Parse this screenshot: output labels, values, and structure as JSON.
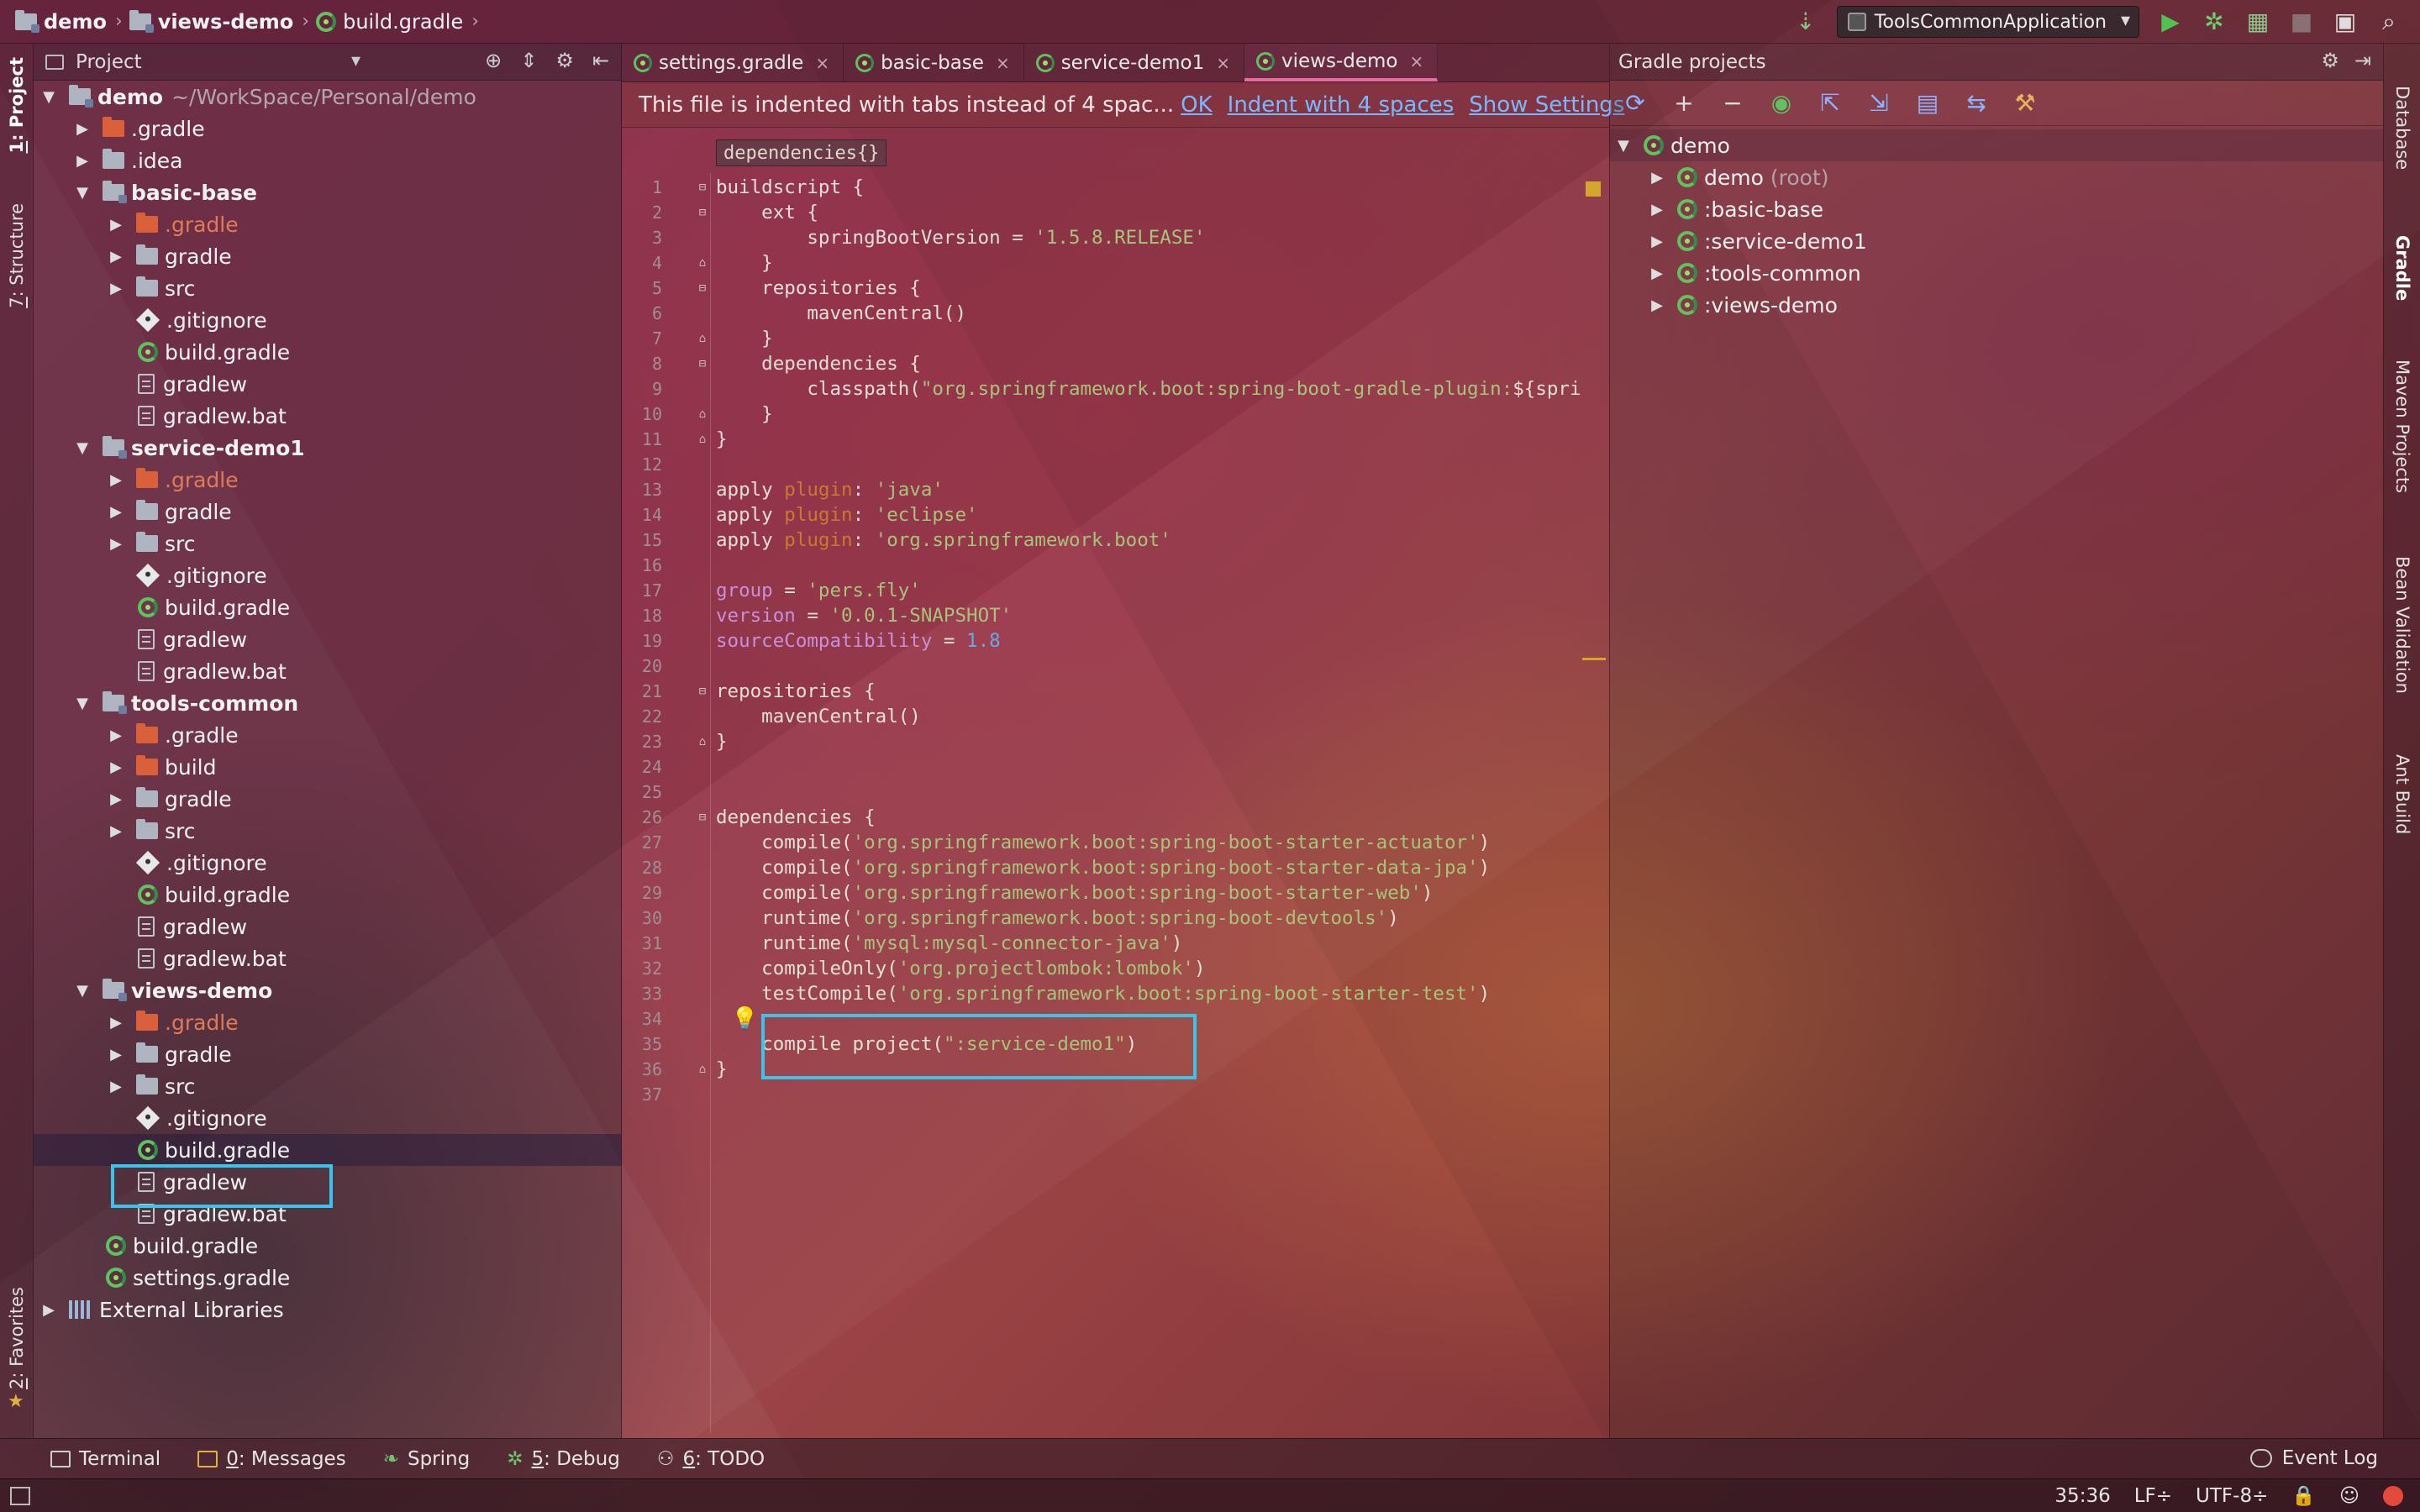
{
  "navbar": {
    "breadcrumb": [
      "demo",
      "views-demo",
      "build.gradle"
    ],
    "run_config": "ToolsCommonApplication"
  },
  "left_strip": {
    "project": {
      "num": "1",
      "label": ": Project"
    },
    "structure": {
      "num": "7",
      "label": ": Structure"
    },
    "favorites": {
      "num": "2",
      "label": ": Favorites"
    }
  },
  "right_strip": [
    "Database",
    "Gradle",
    "Maven Projects",
    "Bean Validation",
    "Ant Build"
  ],
  "project_panel": {
    "title": "Project",
    "tree": [
      {
        "name": "demo",
        "path": "~/WorkSpace/Personal/demo"
      },
      {
        "name": ".gradle"
      },
      {
        "name": ".idea"
      },
      {
        "name": "basic-base"
      },
      {
        "name": ".gradle"
      },
      {
        "name": "gradle"
      },
      {
        "name": "src"
      },
      {
        "name": ".gitignore"
      },
      {
        "name": "build.gradle"
      },
      {
        "name": "gradlew"
      },
      {
        "name": "gradlew.bat"
      },
      {
        "name": "service-demo1"
      },
      {
        "name": ".gradle"
      },
      {
        "name": "gradle"
      },
      {
        "name": "src"
      },
      {
        "name": ".gitignore"
      },
      {
        "name": "build.gradle"
      },
      {
        "name": "gradlew"
      },
      {
        "name": "gradlew.bat"
      },
      {
        "name": "tools-common"
      },
      {
        "name": ".gradle"
      },
      {
        "name": "build"
      },
      {
        "name": "gradle"
      },
      {
        "name": "src"
      },
      {
        "name": ".gitignore"
      },
      {
        "name": "build.gradle"
      },
      {
        "name": "gradlew"
      },
      {
        "name": "gradlew.bat"
      },
      {
        "name": "views-demo"
      },
      {
        "name": ".gradle"
      },
      {
        "name": "gradle"
      },
      {
        "name": "src"
      },
      {
        "name": ".gitignore"
      },
      {
        "name": "build.gradle"
      },
      {
        "name": "gradlew"
      },
      {
        "name": "gradlew.bat"
      },
      {
        "name": "build.gradle"
      },
      {
        "name": "settings.gradle"
      },
      {
        "name": "External Libraries"
      }
    ]
  },
  "editor": {
    "tabs": [
      "settings.gradle",
      "basic-base",
      "service-demo1",
      "views-demo"
    ],
    "notification": {
      "message": "This file is indented with tabs instead of 4 spac...",
      "ok": "OK",
      "indent": "Indent with 4 spaces",
      "settings": "Show Settings"
    },
    "breadcrumb": "dependencies{}",
    "lines": [
      [
        {
          "t": "buildscript {",
          "c": "plain"
        }
      ],
      [
        {
          "t": "    ext {",
          "c": "plain"
        }
      ],
      [
        {
          "t": "        springBootVersion = ",
          "c": "plain"
        },
        {
          "t": "'1.5.8.RELEASE'",
          "c": "str"
        }
      ],
      [
        {
          "t": "    }",
          "c": "plain"
        }
      ],
      [
        {
          "t": "    repositories {",
          "c": "plain"
        }
      ],
      [
        {
          "t": "        mavenCentral()",
          "c": "plain"
        }
      ],
      [
        {
          "t": "    }",
          "c": "plain"
        }
      ],
      [
        {
          "t": "    dependencies {",
          "c": "plain"
        }
      ],
      [
        {
          "t": "        classpath(",
          "c": "plain"
        },
        {
          "t": "\"org.springframework.boot:spring-boot-gradle-plugin:",
          "c": "str"
        },
        {
          "t": "${spri",
          "c": "plain"
        }
      ],
      [
        {
          "t": "    }",
          "c": "plain"
        }
      ],
      [
        {
          "t": "}",
          "c": "plain"
        }
      ],
      [],
      [
        {
          "t": "apply ",
          "c": "plain"
        },
        {
          "t": "plugin",
          "c": "kw"
        },
        {
          "t": ": ",
          "c": "plain"
        },
        {
          "t": "'java'",
          "c": "str"
        }
      ],
      [
        {
          "t": "apply ",
          "c": "plain"
        },
        {
          "t": "plugin",
          "c": "kw"
        },
        {
          "t": ": ",
          "c": "plain"
        },
        {
          "t": "'eclipse'",
          "c": "str"
        }
      ],
      [
        {
          "t": "apply ",
          "c": "plain"
        },
        {
          "t": "plugin",
          "c": "kw"
        },
        {
          "t": ": ",
          "c": "plain"
        },
        {
          "t": "'org.springframework.boot'",
          "c": "str"
        }
      ],
      [],
      [
        {
          "t": "group",
          "c": "prop"
        },
        {
          "t": " = ",
          "c": "plain"
        },
        {
          "t": "'pers.fly'",
          "c": "str"
        }
      ],
      [
        {
          "t": "version",
          "c": "prop"
        },
        {
          "t": " = ",
          "c": "plain"
        },
        {
          "t": "'0.0.1-SNAPSHOT'",
          "c": "str"
        }
      ],
      [
        {
          "t": "sourceCompatibility",
          "c": "prop"
        },
        {
          "t": " = ",
          "c": "plain"
        },
        {
          "t": "1.8",
          "c": "num"
        }
      ],
      [],
      [
        {
          "t": "repositories {",
          "c": "plain"
        }
      ],
      [
        {
          "t": "    mavenCentral()",
          "c": "plain"
        }
      ],
      [
        {
          "t": "}",
          "c": "plain"
        }
      ],
      [],
      [],
      [
        {
          "t": "dependencies {",
          "c": "plain"
        }
      ],
      [
        {
          "t": "    compile(",
          "c": "plain"
        },
        {
          "t": "'org.springframework.boot:spring-boot-starter-actuator'",
          "c": "str"
        },
        {
          "t": ")",
          "c": "plain"
        }
      ],
      [
        {
          "t": "    compile(",
          "c": "plain"
        },
        {
          "t": "'org.springframework.boot:spring-boot-starter-data-jpa'",
          "c": "str"
        },
        {
          "t": ")",
          "c": "plain"
        }
      ],
      [
        {
          "t": "    compile(",
          "c": "plain"
        },
        {
          "t": "'org.springframework.boot:spring-boot-starter-web'",
          "c": "str"
        },
        {
          "t": ")",
          "c": "plain"
        }
      ],
      [
        {
          "t": "    runtime(",
          "c": "plain"
        },
        {
          "t": "'org.springframework.boot:spring-boot-devtools'",
          "c": "str"
        },
        {
          "t": ")",
          "c": "plain"
        }
      ],
      [
        {
          "t": "    runtime(",
          "c": "plain"
        },
        {
          "t": "'mysql:mysql-connector-java'",
          "c": "str"
        },
        {
          "t": ")",
          "c": "plain"
        }
      ],
      [
        {
          "t": "    compileOnly(",
          "c": "plain"
        },
        {
          "t": "'org.projectlombok:lombok'",
          "c": "str"
        },
        {
          "t": ")",
          "c": "plain"
        }
      ],
      [
        {
          "t": "    testCompile(",
          "c": "plain"
        },
        {
          "t": "'org.springframework.boot:spring-boot-starter-test'",
          "c": "str"
        },
        {
          "t": ")",
          "c": "plain"
        }
      ],
      [],
      [
        {
          "t": "    compile project(",
          "c": "plain"
        },
        {
          "t": "\":service-demo1\"",
          "c": "str"
        },
        {
          "t": ")",
          "c": "plain"
        }
      ],
      [
        {
          "t": "}",
          "c": "plain"
        }
      ],
      []
    ]
  },
  "gradle_panel": {
    "title": "Gradle projects",
    "tree": [
      {
        "name": "demo"
      },
      {
        "name": "demo",
        "note": "(root)"
      },
      {
        "name": ":basic-base"
      },
      {
        "name": ":service-demo1"
      },
      {
        "name": ":tools-common"
      },
      {
        "name": ":views-demo"
      }
    ]
  },
  "bottom_tools": {
    "terminal": "Terminal",
    "messages": {
      "num": "0",
      "label": ": Messages"
    },
    "spring": "Spring",
    "debug": {
      "num": "5",
      "label": ": Debug"
    },
    "todo": {
      "num": "6",
      "label": ": TODO"
    },
    "event_log": "Event Log"
  },
  "statusbar": {
    "position": "35:36",
    "line_sep": "LF÷",
    "encoding": "UTF-8÷"
  },
  "colors": {
    "accent_highlight": "#39c5e9",
    "string": "#a8c37a",
    "keyword": "#cc7832",
    "property": "#c890d6",
    "number": "#6ea7e6",
    "link": "#77b9ff"
  }
}
